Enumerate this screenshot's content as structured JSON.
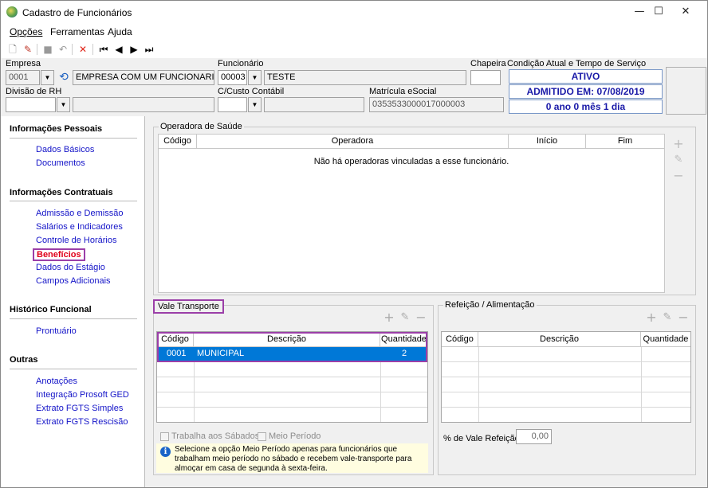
{
  "window": {
    "title": "Cadastro de Funcionários",
    "minimize": "—",
    "maximize": "☐",
    "close": "✕"
  },
  "menu": {
    "opcoes": "Opções",
    "ferramentas": "Ferramentas",
    "ajuda": "Ajuda"
  },
  "header": {
    "empresa_label": "Empresa",
    "empresa_code": "0001",
    "empresa_name": "EMPRESA COM UM FUNCIONARIO",
    "funcionario_label": "Funcionário",
    "funcionario_code": "00003",
    "funcionario_name": "TESTE",
    "chapeira_label": "Chapeira",
    "chapeira_value": "",
    "condicao_label": "Condição Atual e Tempo de Serviço",
    "status": "ATIVO",
    "admitido": "ADMITIDO EM: 07/08/2019",
    "tempo": "0 ano 0 mês 1 dia",
    "divisao_label": "Divisão de RH",
    "divisao_code": "",
    "divisao_name": "",
    "custo_label": "C/Custo Contábil",
    "custo_code": "",
    "custo_name": "",
    "matricula_label": "Matrícula eSocial",
    "matricula_value": "0353533000017000003"
  },
  "sidebar": {
    "sections": [
      {
        "title": "Informações Pessoais",
        "items": [
          "Dados Básicos",
          "Documentos"
        ]
      },
      {
        "title": "Informações Contratuais",
        "items": [
          "Admissão e Demissão",
          "Salários e Indicadores",
          "Controle de Horários",
          "Benefícios",
          "Dados do Estágio",
          "Campos Adicionais"
        ]
      },
      {
        "title": "Histórico Funcional",
        "items": [
          "Prontuário"
        ]
      },
      {
        "title": "Outras",
        "items": [
          "Anotações",
          "Integração Prosoft GED",
          "Extrato FGTS Simples",
          "Extrato FGTS Rescisão"
        ]
      }
    ]
  },
  "saude": {
    "title": "Operadora de Saúde",
    "cols": [
      "Código",
      "Operadora",
      "Início",
      "Fim"
    ],
    "empty": "Não há operadoras vinculadas a esse funcionário."
  },
  "vale": {
    "title": "Vale Transporte",
    "cols": [
      "Código",
      "Descrição",
      "Quantidade"
    ],
    "rows": [
      {
        "codigo": "0001",
        "descricao": "MUNICIPAL",
        "quantidade": "2"
      }
    ],
    "chk_sabados": "Trabalha aos Sábados?",
    "chk_meio": "Meio Período",
    "info": "Selecione a opção Meio Período apenas para funcionários que trabalham meio período no sábado e recebem vale-transporte para almoçar em casa de segunda à sexta-feira."
  },
  "refeicao": {
    "title": "Refeição / Alimentação",
    "cols": [
      "Código",
      "Descrição",
      "Quantidade"
    ],
    "pct_label": "% de Vale Refeição",
    "pct_value": "0,00"
  },
  "colors": {
    "accent": "#0078d7",
    "highlight": "#9b3fa8",
    "link": "#1414c8",
    "active": "#e0001a"
  }
}
